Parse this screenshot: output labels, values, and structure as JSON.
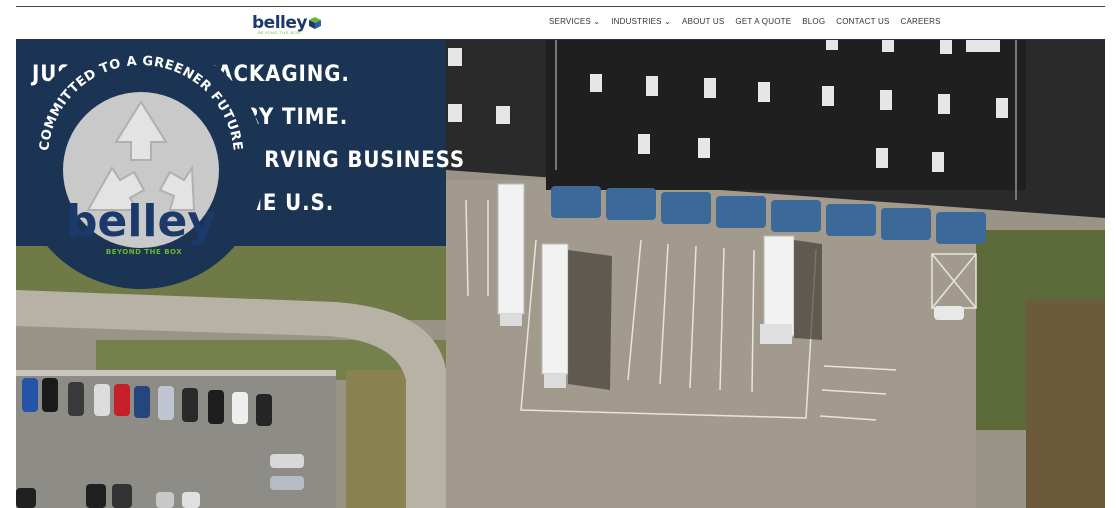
{
  "brand": {
    "logo_text": "belley",
    "tagline": "BEYOND THE BOX",
    "colors": {
      "navy": "#1b3454",
      "green": "#66b82f",
      "logo_blue": "#1b3a6b"
    }
  },
  "nav": {
    "items": [
      {
        "label": "SERVICES ⌄"
      },
      {
        "label": "INDUSTRIES ⌄"
      },
      {
        "label": "ABOUT US"
      },
      {
        "label": "GET A QUOTE"
      },
      {
        "label": "BLOG"
      },
      {
        "label": "CONTACT US"
      },
      {
        "label": "CAREERS"
      }
    ]
  },
  "hero": {
    "headline": [
      "JUST ENOUGH PACKAGING.",
      "JUST-IN-TIME. EVERY TIME.",
      "THAT'S BELLEY - SERVING BUSINESS",
      "IN CANADA AND THE U.S."
    ],
    "badge": {
      "arc_text": "COMMITTED TO A GREENER FUTURE",
      "logo_text": "belley",
      "tagline": "BEYOND THE BOX",
      "icon": "recycle-icon"
    }
  }
}
